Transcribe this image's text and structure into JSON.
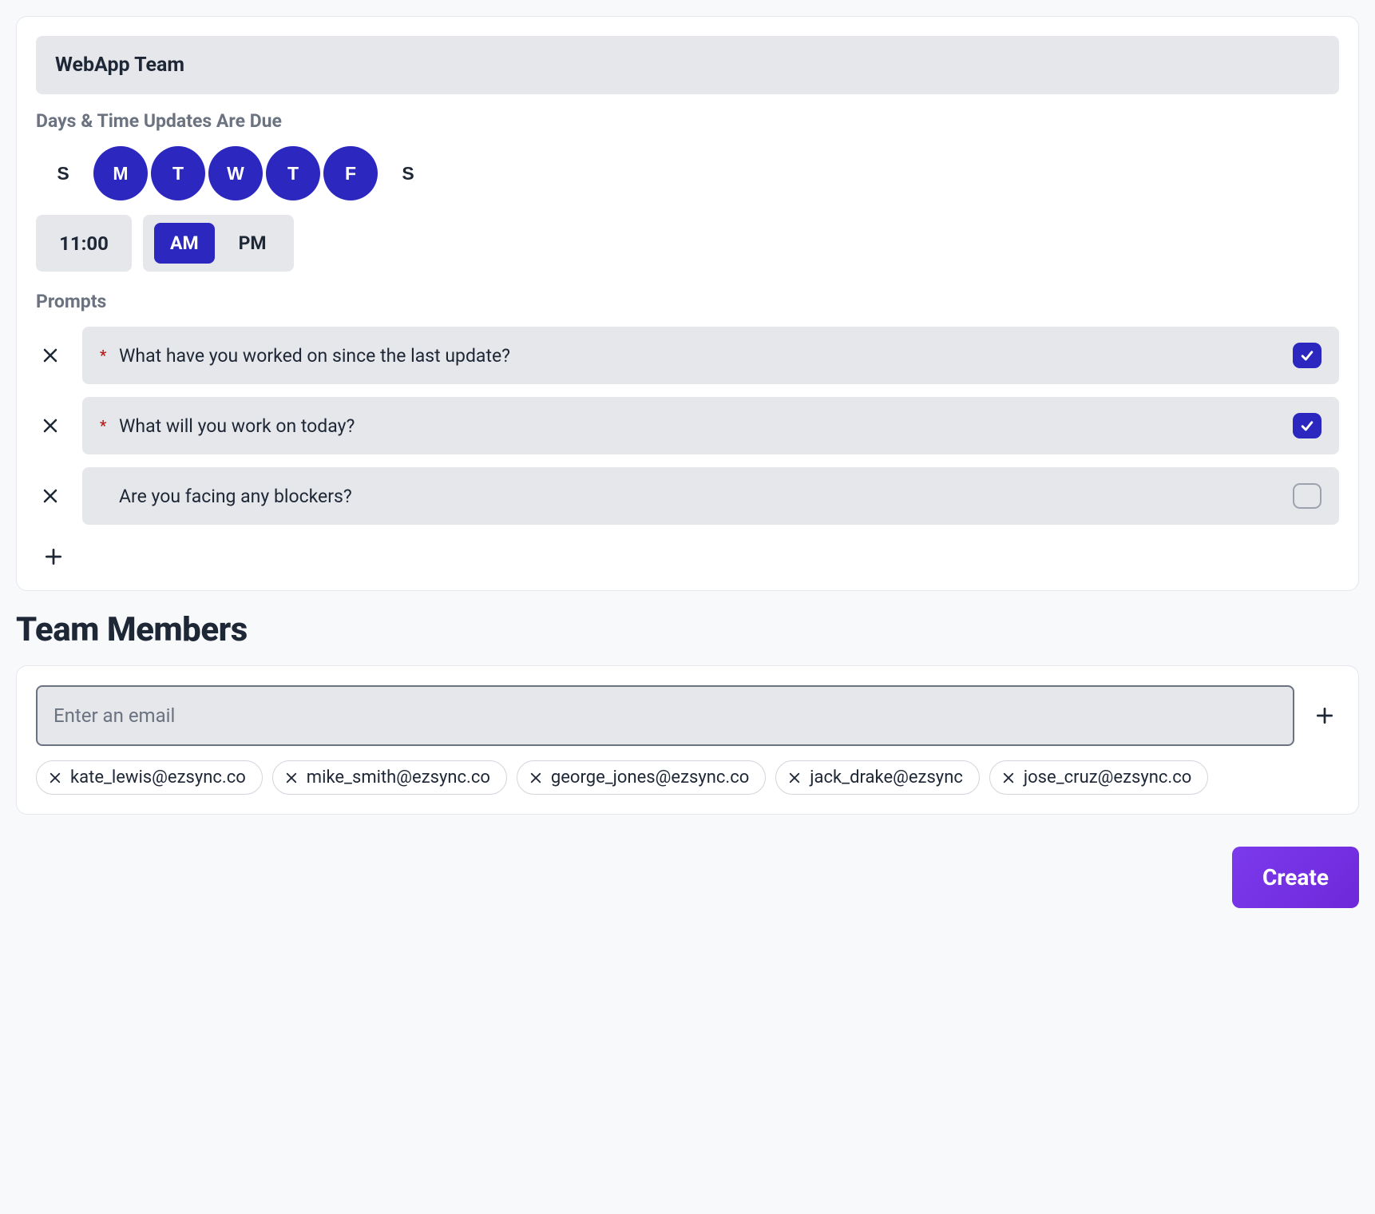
{
  "team_name": "WebApp Team",
  "schedule": {
    "label": "Days & Time Updates Are Due",
    "days": [
      {
        "letter": "S",
        "selected": false
      },
      {
        "letter": "M",
        "selected": true
      },
      {
        "letter": "T",
        "selected": true
      },
      {
        "letter": "W",
        "selected": true
      },
      {
        "letter": "T",
        "selected": true
      },
      {
        "letter": "F",
        "selected": true
      },
      {
        "letter": "S",
        "selected": false
      }
    ],
    "time": "11:00",
    "am_label": "AM",
    "pm_label": "PM",
    "meridiem": "AM"
  },
  "prompts": {
    "label": "Prompts",
    "items": [
      {
        "text": "What have you worked on since the last update?",
        "required": true
      },
      {
        "text": "What will you work on today?",
        "required": true
      },
      {
        "text": "Are you facing any blockers?",
        "required": false
      }
    ]
  },
  "members": {
    "heading": "Team Members",
    "email_placeholder": "Enter an email",
    "list": [
      "kate_lewis@ezsync.co",
      "mike_smith@ezsync.co",
      "george_jones@ezsync.co",
      "jack_drake@ezsync",
      "jose_cruz@ezsync.co"
    ]
  },
  "create_label": "Create"
}
